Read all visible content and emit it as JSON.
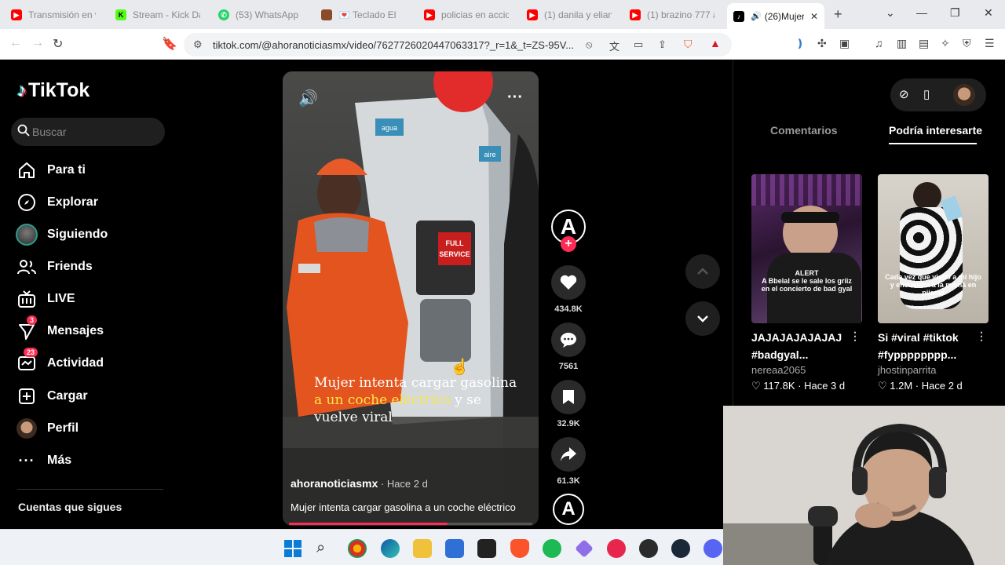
{
  "browser": {
    "tabs": [
      {
        "label": "Transmisión en vi",
        "color": "#ff0000",
        "icon": "youtube-icon"
      },
      {
        "label": "Stream - Kick Da",
        "color": "#53fc18",
        "icon": "kick-icon"
      },
      {
        "label": "(53) WhatsApp",
        "color": "#25d366",
        "icon": "whatsapp-icon"
      },
      {
        "label": "Teclado El",
        "color": "#8a4b2a",
        "icon": "site-icon"
      },
      {
        "label": "policias en accion",
        "color": "#ff0000",
        "icon": "youtube-icon"
      },
      {
        "label": "(1) danila y elian",
        "color": "#ff0000",
        "icon": "youtube-icon"
      },
      {
        "label": "(1) brazino 777 a",
        "color": "#ff0000",
        "icon": "youtube-icon"
      },
      {
        "label": "(26)Mujer",
        "color": "#000000",
        "icon": "tiktok-icon",
        "active": true
      }
    ],
    "url": "tiktok.com/@ahoranoticiasmx/video/7627726020447063317?_r=1&_t=ZS-95V..."
  },
  "sidebar": {
    "logo": "TikTok",
    "search_placeholder": "Buscar",
    "items": [
      {
        "label": "Para ti",
        "icon": "home-icon"
      },
      {
        "label": "Explorar",
        "icon": "compass-icon"
      },
      {
        "label": "Siguiendo",
        "icon": "following-avatar-icon"
      },
      {
        "label": "Friends",
        "icon": "friends-icon"
      },
      {
        "label": "LIVE",
        "icon": "live-icon"
      },
      {
        "label": "Mensajes",
        "icon": "messages-icon",
        "badge": "3"
      },
      {
        "label": "Actividad",
        "icon": "activity-icon",
        "badge": "23"
      },
      {
        "label": "Cargar",
        "icon": "upload-icon"
      },
      {
        "label": "Perfil",
        "icon": "profile-avatar-icon"
      },
      {
        "label": "Más",
        "icon": "more-icon"
      }
    ],
    "following_title": "Cuentas que sigues"
  },
  "video": {
    "caption_part1": "Mujer intenta cargar gasolina ",
    "caption_highlight": "a un coche eléctrico",
    "caption_part2": " y se vuelve viral",
    "author": "ahoranoticiasmx",
    "time": " · Hace 2 d",
    "description": "Mujer intenta cargar gasolina a un coche eléctrico",
    "progress": 0.65,
    "sign_text": "FULL SERVICE",
    "pump_label_1": "agua",
    "pump_label_2": "aire"
  },
  "actions": {
    "creator_initial": "A",
    "likes": "434.8K",
    "comments": "7561",
    "saves": "32.9K",
    "shares": "61.3K"
  },
  "right_panel": {
    "tabs": [
      {
        "label": "Comentarios",
        "active": false
      },
      {
        "label": "Podría interesarte",
        "active": true
      }
    ],
    "cards": [
      {
        "title": "JAJAJAJAJAJAJ #badgyal...",
        "author": "nereaa2065",
        "likes": "117.8K",
        "time": "Hace 3 d",
        "overlay_tag": "ALERT",
        "overlay": "A Bbelal se le sale los griiz en el concierto de bad gyal"
      },
      {
        "title": "Si #viral #tiktok #fypppppppp...",
        "author": "jhostinparrita",
        "likes": "1.2M",
        "time": "Hace 2 d",
        "overlay": "Cada vez que visito a mi hijo y encuentra a la mamá en pijama"
      }
    ]
  },
  "colors": {
    "accent": "#fe2c55",
    "caption_highlight": "#f7e64a",
    "background": "#000000"
  }
}
